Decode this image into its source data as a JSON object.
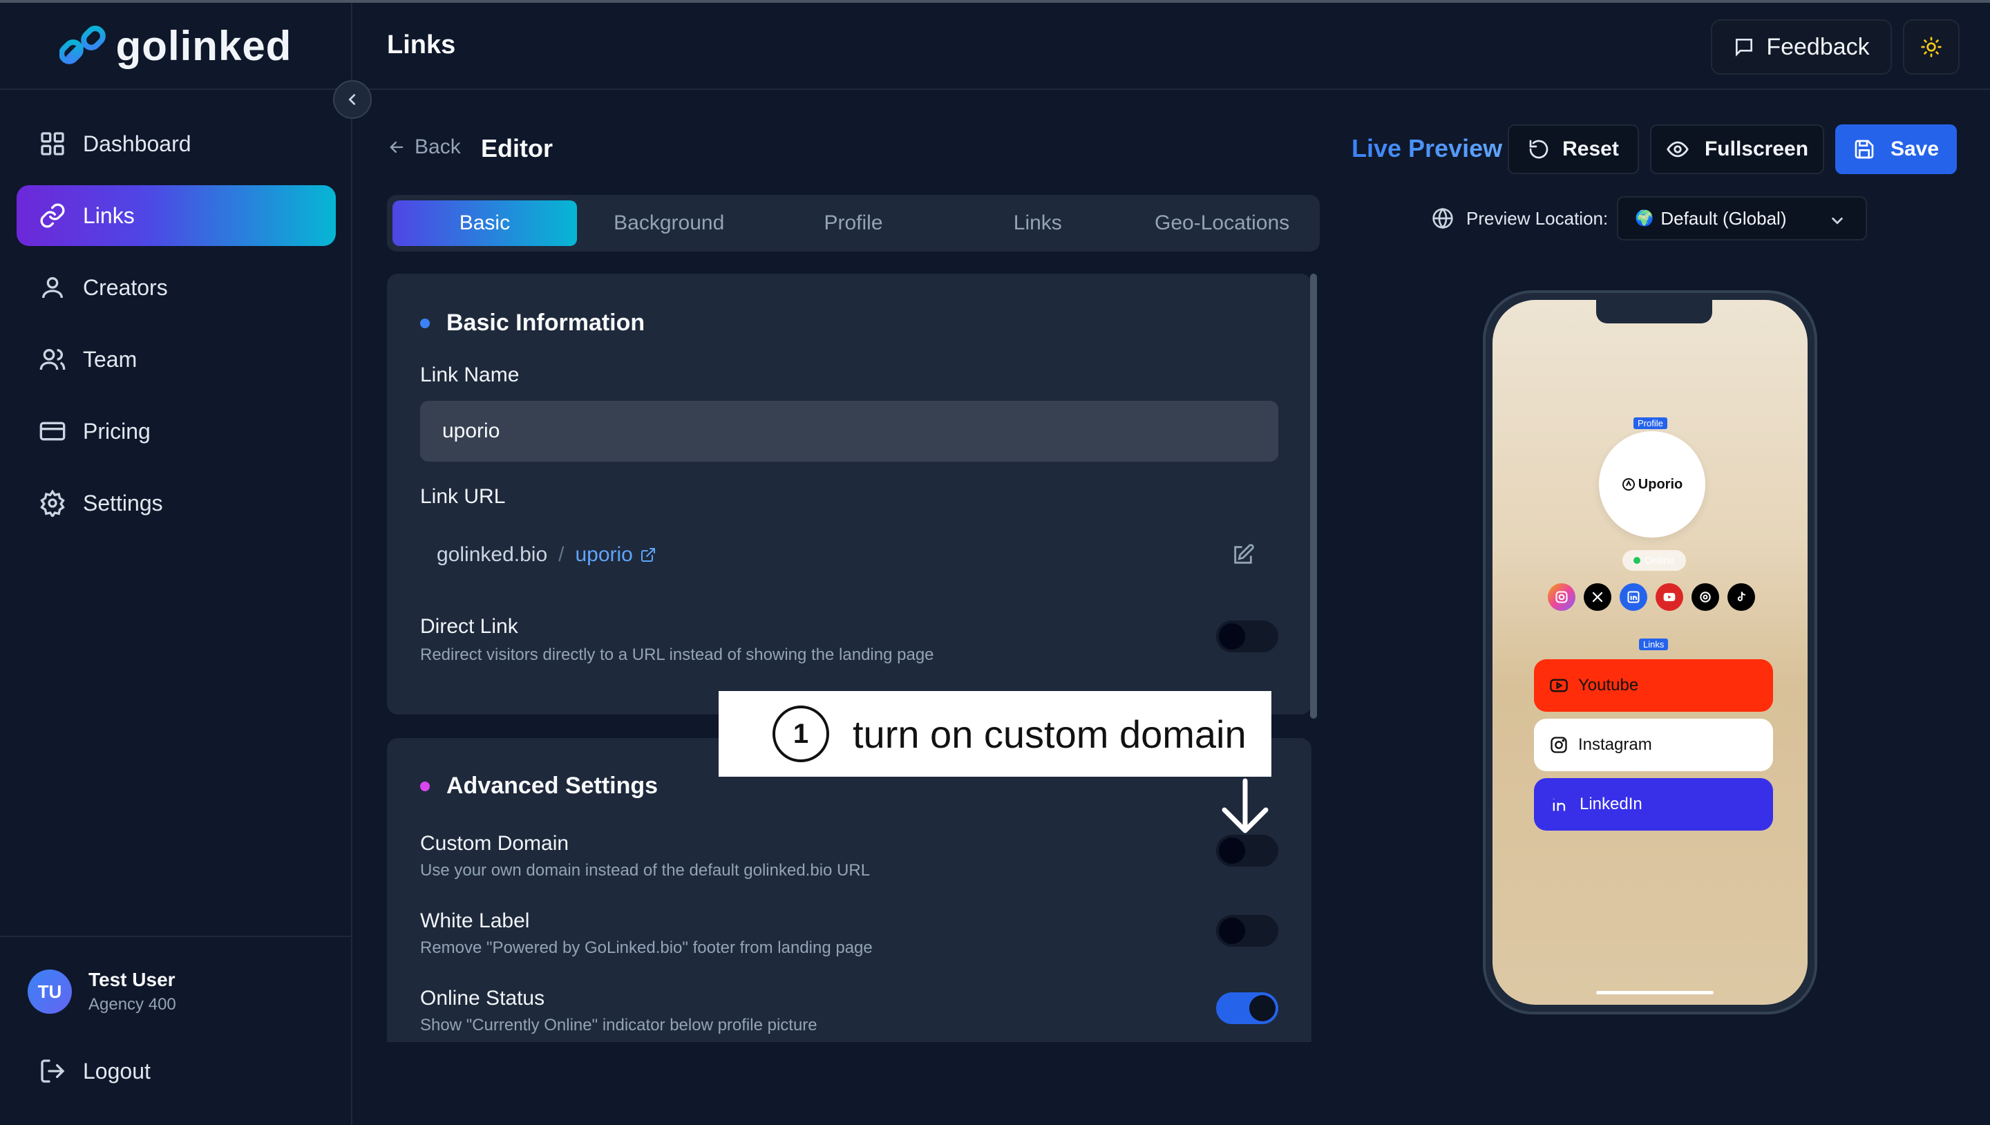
{
  "brand": {
    "name": "golinked"
  },
  "sidebar": {
    "items": [
      {
        "label": "Dashboard",
        "icon": "grid-icon"
      },
      {
        "label": "Links",
        "icon": "link-icon",
        "active": true
      },
      {
        "label": "Creators",
        "icon": "user-icon"
      },
      {
        "label": "Team",
        "icon": "users-icon"
      },
      {
        "label": "Pricing",
        "icon": "credit-card-icon"
      },
      {
        "label": "Settings",
        "icon": "gear-icon"
      }
    ],
    "user": {
      "initials": "TU",
      "name": "Test User",
      "plan": "Agency 400"
    },
    "logout": "Logout"
  },
  "header": {
    "title": "Links",
    "feedback": "Feedback"
  },
  "editor": {
    "back": "Back",
    "title": "Editor",
    "live_preview": "Live Preview",
    "reset": "Reset",
    "fullscreen": "Fullscreen",
    "save": "Save"
  },
  "tabs": [
    "Basic",
    "Background",
    "Profile",
    "Links",
    "Geo-Locations"
  ],
  "basic": {
    "section_title": "Basic Information",
    "link_name_label": "Link Name",
    "link_name_value": "uporio",
    "link_url_label": "Link URL",
    "url_domain": "golinked.bio",
    "url_sep": "/",
    "url_slug": "uporio",
    "direct_link_label": "Direct Link",
    "direct_link_desc": "Redirect visitors directly to a URL instead of showing the landing page"
  },
  "advanced": {
    "section_title": "Advanced Settings",
    "custom_domain_label": "Custom Domain",
    "custom_domain_desc": "Use your own domain instead of the default golinked.bio URL",
    "white_label_label": "White Label",
    "white_label_desc": "Remove \"Powered by GoLinked.bio\" footer from landing page",
    "online_status_label": "Online Status",
    "online_status_desc": "Show \"Currently Online\" indicator below profile picture"
  },
  "toggles": {
    "direct_link": false,
    "custom_domain": false,
    "white_label": false,
    "online_status": true
  },
  "callout": {
    "number": "1",
    "text": "turn on custom domain"
  },
  "preview": {
    "location_label": "Preview Location:",
    "location_value": "Default (Global)",
    "profile_tag": "Profile",
    "profile_name": "Uporio",
    "online": "Online",
    "links_tag": "Links",
    "links": [
      {
        "label": "Youtube",
        "icon": "youtube-icon",
        "bg": "#ff2d0a",
        "fg": "#111111"
      },
      {
        "label": "Instagram",
        "icon": "instagram-icon",
        "bg": "#ffffff",
        "fg": "#111111"
      },
      {
        "label": "LinkedIn",
        "icon": "linkedin-icon",
        "bg": "#3730e8",
        "fg": "#ffffff"
      }
    ],
    "socials": [
      "instagram-icon",
      "x-icon",
      "linkedin-icon",
      "youtube-icon",
      "threads-icon",
      "tiktok-icon"
    ]
  },
  "colors": {
    "accent": "#2563eb",
    "active_gradient_start": "#6d28d9",
    "active_gradient_end": "#06b6d4",
    "background": "#0f172a",
    "card": "#1e293b"
  }
}
